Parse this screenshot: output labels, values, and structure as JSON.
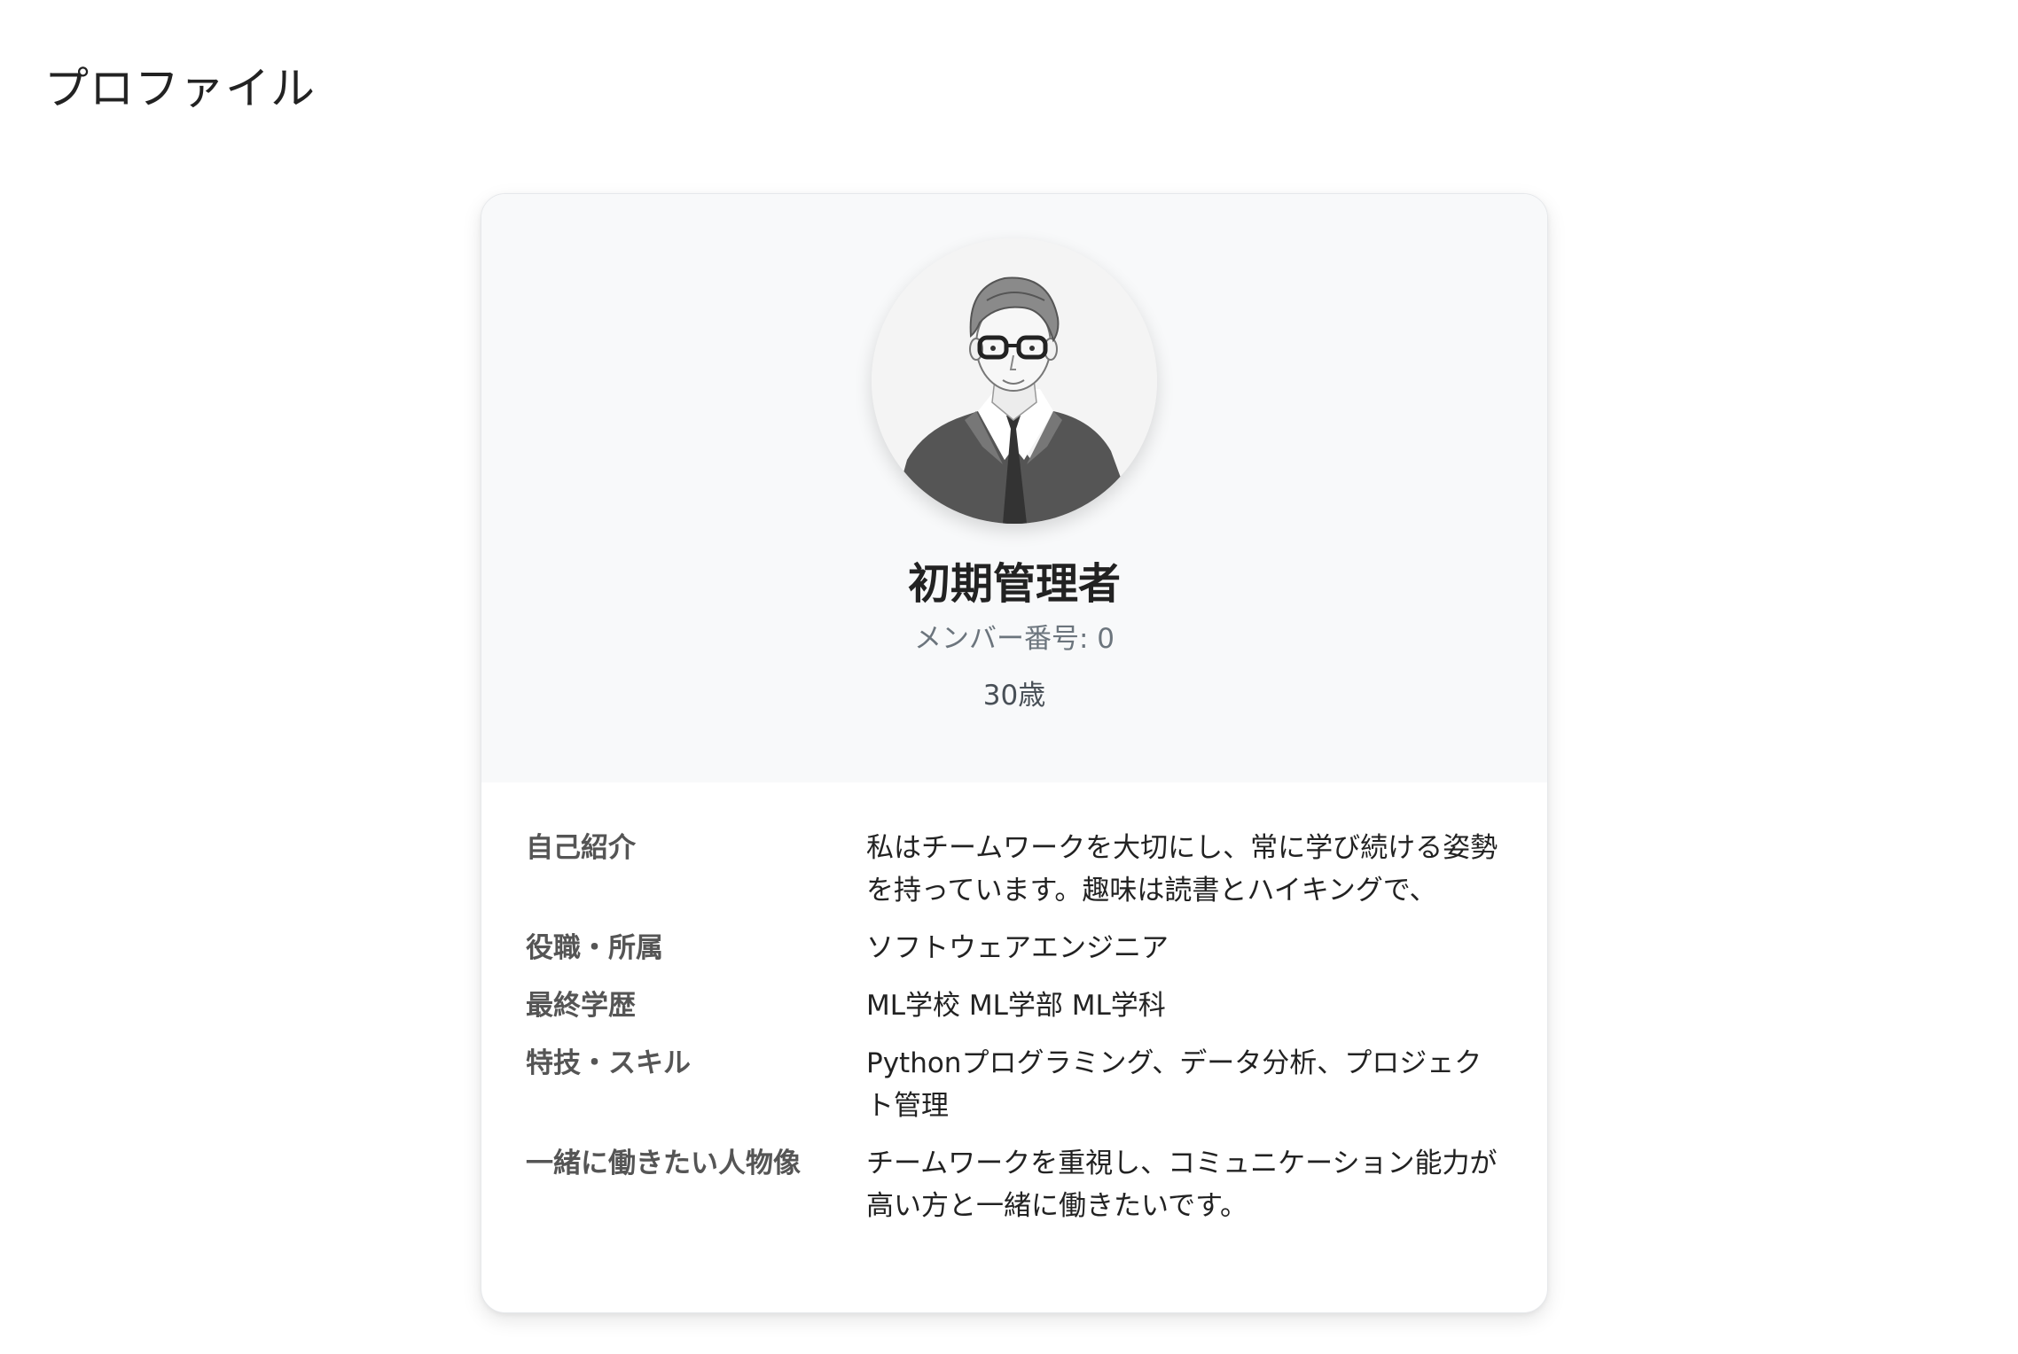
{
  "page": {
    "title": "プロファイル"
  },
  "profile": {
    "avatar_icon": "avatar-illustration-man-in-suit",
    "name": "初期管理者",
    "member_number": "メンバー番号: 0",
    "age": "30歳",
    "header_background": "#f8f9fa"
  },
  "details": [
    {
      "label": "自己紹介",
      "value": "私はチームワークを大切にし、常に学び続ける姿勢を持っています。趣味は読書とハイキングで、"
    },
    {
      "label": "役職・所属",
      "value": "ソフトウェアエンジニア"
    },
    {
      "label": "最終学歴",
      "value": "ML学校 ML学部 ML学科"
    },
    {
      "label": "特技・スキル",
      "value": "Pythonプログラミング、データ分析、プロジェクト管理"
    },
    {
      "label": "一緒に働きたい人物像",
      "value": "チームワークを重視し、コミュニケーション能力が高い方と一緒に働きたいです。"
    }
  ]
}
